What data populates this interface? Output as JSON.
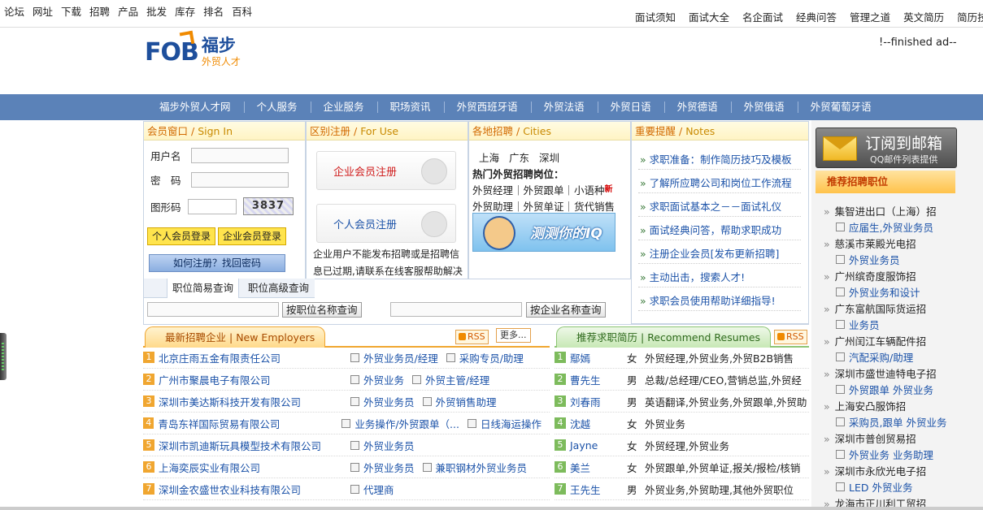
{
  "top_left_links": [
    "论坛",
    "网址",
    "下载",
    "招聘",
    "产品",
    "批发",
    "库存",
    "排名",
    "百科"
  ],
  "top_right_links": [
    "面试须知",
    "面试大全",
    "名企面试",
    "经典问答",
    "管理之道",
    "英文简历",
    "简历技巧"
  ],
  "logo": {
    "mark": "FOB",
    "name": "福步",
    "tagline": "外贸人才"
  },
  "ad_comment": "!--finished ad--",
  "nav": [
    "福步外贸人才网",
    "个人服务",
    "企业服务",
    "职场资讯",
    "外贸西班牙语",
    "外贸法语",
    "外贸日语",
    "外贸德语",
    "外贸俄语",
    "外贸葡萄牙语"
  ],
  "login": {
    "title": "会员窗口",
    "title_en": "Sign In",
    "username_label": "用户名",
    "password_label": "密　码",
    "captcha_label": "图形码",
    "captcha_text": "3837",
    "personal_login": "个人会员登录",
    "company_login": "企业会员登录",
    "forgot": "如何注册？找回密码"
  },
  "register": {
    "title": "区别注册",
    "title_en": "For Use",
    "company_btn": "企业会员注册",
    "personal_btn": "个人会员注册",
    "note": "企业用户不能发布招聘或是招聘信息已过期,请联系在线客服帮助解决"
  },
  "cities": {
    "title": "各地招聘",
    "title_en": "Cities",
    "list": [
      "上海",
      "广东",
      "深圳"
    ],
    "hot_title": "热门外贸招聘岗位：",
    "line1": "外贸经理｜外贸跟单｜小语种",
    "new_tag": "新",
    "line2": "外贸助理｜外贸单证｜货代销售",
    "banner_text": "测测你的IQ"
  },
  "notes": {
    "title": "重要提醒",
    "title_en": "Notes",
    "items": [
      "求职准备：制作简历技巧及模板",
      "了解所应聘公司和岗位工作流程",
      "求职面试基本之－－面试礼仪",
      "面试经典问答，帮助求职成功",
      "注册企业会员[发布更新招聘]",
      "主动出击，搜索人才!",
      "求职会员使用帮助详细指导!"
    ]
  },
  "search": {
    "tab_simple": "职位简易查询",
    "tab_advanced": "职位高级查询",
    "btn_job": "按职位名称查询",
    "btn_company": "按企业名称查询"
  },
  "employers": {
    "title": "最新招聘企业",
    "title_en": "New Employers",
    "rss": "RSS",
    "more": "更多...",
    "rows": [
      {
        "n": "1",
        "company": "北京庄雨五金有限责任公司",
        "jobs": [
          "外贸业务员/经理",
          "采购专员/助理"
        ]
      },
      {
        "n": "2",
        "company": "广州市聚晨电子有限公司",
        "jobs": [
          "外贸业务",
          "外贸主管/经理"
        ]
      },
      {
        "n": "3",
        "company": "深圳市美达斯科技开发有限公司",
        "jobs": [
          "外贸业务员",
          "外贸销售助理"
        ]
      },
      {
        "n": "4",
        "company": "青岛东祥国际贸易有限公司",
        "jobs": [
          "业务操作/外贸跟单（...",
          "日线海运操作"
        ]
      },
      {
        "n": "5",
        "company": "深圳市凯迪斯玩具模型技术有限公司",
        "jobs": [
          "外贸业务员"
        ]
      },
      {
        "n": "6",
        "company": "上海奕辰实业有限公司",
        "jobs": [
          "外贸业务员",
          "兼职钢材外贸业务员"
        ]
      },
      {
        "n": "7",
        "company": "深圳金农盛世农业科技有限公司",
        "jobs": [
          "代理商"
        ]
      }
    ]
  },
  "resumes": {
    "title": "推荐求职简历",
    "title_en": "Recommend Resumes",
    "rss": "RSS",
    "rows": [
      {
        "n": "1",
        "name": "鄢嫣",
        "gender": "女",
        "desc": "外贸经理,外贸业务,外贸B2B销售"
      },
      {
        "n": "2",
        "name": "曹先生",
        "gender": "男",
        "desc": "总裁/总经理/CEO,营销总监,外贸经"
      },
      {
        "n": "3",
        "name": "刘春雨",
        "gender": "男",
        "desc": "英语翻译,外贸业务,外贸跟单,外贸助"
      },
      {
        "n": "4",
        "name": "沈越",
        "gender": "女",
        "desc": "外贸业务"
      },
      {
        "n": "5",
        "name": "Jayne",
        "gender": "女",
        "desc": "外贸经理,外贸业务"
      },
      {
        "n": "6",
        "name": "美兰",
        "gender": "女",
        "desc": "外贸跟单,外贸单证,报关/报检/核销"
      },
      {
        "n": "7",
        "name": "王先生",
        "gender": "男",
        "desc": "外贸业务,外贸助理,其他外贸职位"
      }
    ]
  },
  "subscribe": {
    "title": "订阅到邮箱",
    "subtitle": "QQ邮件列表提供"
  },
  "recommended": {
    "title": "推荐招聘职位",
    "items": [
      {
        "type": "co",
        "text": "集智进出口（上海）招"
      },
      {
        "type": "job",
        "text": "应届生,外贸业务员"
      },
      {
        "type": "co",
        "text": "慈溪市莱殿光电招"
      },
      {
        "type": "job",
        "text": "外贸业务员"
      },
      {
        "type": "co",
        "text": "广州缤奇度服饰招"
      },
      {
        "type": "job",
        "text": "外贸业务和设计"
      },
      {
        "type": "co",
        "text": "广东富航国际货运招"
      },
      {
        "type": "job",
        "text": "业务员"
      },
      {
        "type": "co",
        "text": "广州闰江车辆配件招"
      },
      {
        "type": "job",
        "text": "汽配采购/助理"
      },
      {
        "type": "co",
        "text": "深圳市盛世迪特电子招"
      },
      {
        "type": "job",
        "text": "外贸跟单 外贸业务"
      },
      {
        "type": "co",
        "text": "上海安凸服饰招"
      },
      {
        "type": "job",
        "text": "采购员,跟单 外贸业务"
      },
      {
        "type": "co",
        "text": "深圳市普创贸易招"
      },
      {
        "type": "job",
        "text": "外贸业务 业务助理"
      },
      {
        "type": "co",
        "text": "深圳市永欣光电子招"
      },
      {
        "type": "job",
        "text": "LED 外贸业务"
      },
      {
        "type": "co",
        "text": "龙海市正川利工贸招"
      }
    ]
  }
}
